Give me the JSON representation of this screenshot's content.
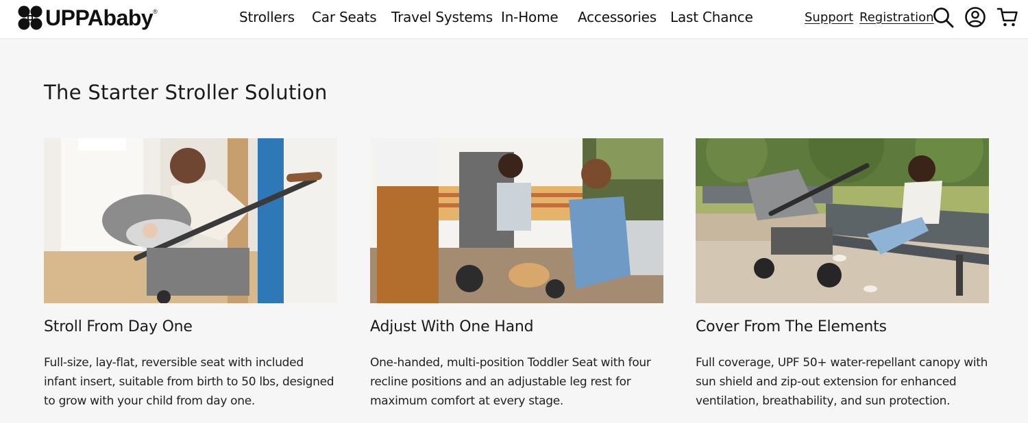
{
  "header": {
    "logo_text": "UPPAbaby",
    "logo_mark": "®",
    "nav": [
      "Strollers",
      "Car Seats",
      "Travel Systems",
      "In-Home",
      "Accessories",
      "Last Chance"
    ],
    "support_label": "Support",
    "registration_label": "Registration",
    "icons": [
      "search-icon",
      "account-icon",
      "cart-icon"
    ]
  },
  "main": {
    "title": "The Starter Stroller Solution",
    "cards": [
      {
        "title": "Stroll From Day One",
        "desc": "Full-size, lay-flat, reversible seat with included infant insert, suitable from birth to 50 lbs, designed to grow with your child from day one.",
        "image": "parent-with-infant-in-stroller-photo"
      },
      {
        "title": "Adjust With One Hand",
        "desc": "One-handed, multi-position Toddler Seat with four recline positions and an adjustable leg rest for maximum comfort at every stage.",
        "image": "toddler-in-stroller-porch-photo"
      },
      {
        "title": "Cover From The Elements",
        "desc": "Full coverage, UPF 50+ water-repellant canopy with sun shield and zip-out extension for enhanced ventilation, breathability, and sun protection.",
        "image": "woman-on-park-bench-with-stroller-photo"
      }
    ]
  }
}
